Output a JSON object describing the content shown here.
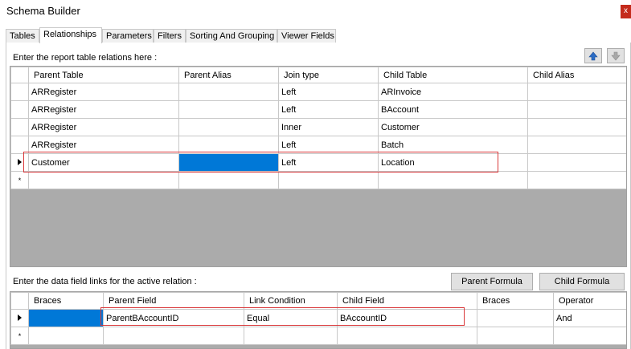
{
  "window": {
    "title": "Schema Builder",
    "close_label": "x"
  },
  "tabs": [
    "Tables",
    "Relationships",
    "Parameters",
    "Filters",
    "Sorting And Grouping",
    "Viewer Fields"
  ],
  "relations": {
    "label": "Enter the report table relations here :",
    "columns": [
      "Parent Table",
      "Parent Alias",
      "Join type",
      "Child Table",
      "Child Alias"
    ],
    "rows": [
      {
        "parent_table": "ARRegister",
        "parent_alias": "",
        "join_type": "Left",
        "child_table": "ARInvoice",
        "child_alias": ""
      },
      {
        "parent_table": "ARRegister",
        "parent_alias": "",
        "join_type": "Left",
        "child_table": "BAccount",
        "child_alias": ""
      },
      {
        "parent_table": "ARRegister",
        "parent_alias": "",
        "join_type": "Inner",
        "child_table": "Customer",
        "child_alias": ""
      },
      {
        "parent_table": "ARRegister",
        "parent_alias": "",
        "join_type": "Left",
        "child_table": "Batch",
        "child_alias": ""
      },
      {
        "parent_table": "Customer",
        "parent_alias": "",
        "join_type": "Left",
        "child_table": "Location",
        "child_alias": ""
      }
    ],
    "new_row_marker": "*",
    "move_up_icon": "arrow-up-icon",
    "move_down_icon": "arrow-down-icon"
  },
  "links": {
    "label": "Enter the data field links for the active relation :",
    "parent_formula_button": "Parent Formula",
    "child_formula_button": "Child Formula",
    "columns": [
      "Braces",
      "Parent Field",
      "Link Condition",
      "Child Field",
      "Braces",
      "Operator"
    ],
    "rows": [
      {
        "open_braces": "",
        "parent_field": "ParentBAccountID",
        "link_condition": "Equal",
        "child_field": "BAccountID",
        "close_braces": "",
        "operator": "And"
      }
    ],
    "new_row_marker": "*"
  },
  "colors": {
    "selection": "#0078d7",
    "highlight_border": "#d9383a",
    "grid_background": "#ababab"
  }
}
